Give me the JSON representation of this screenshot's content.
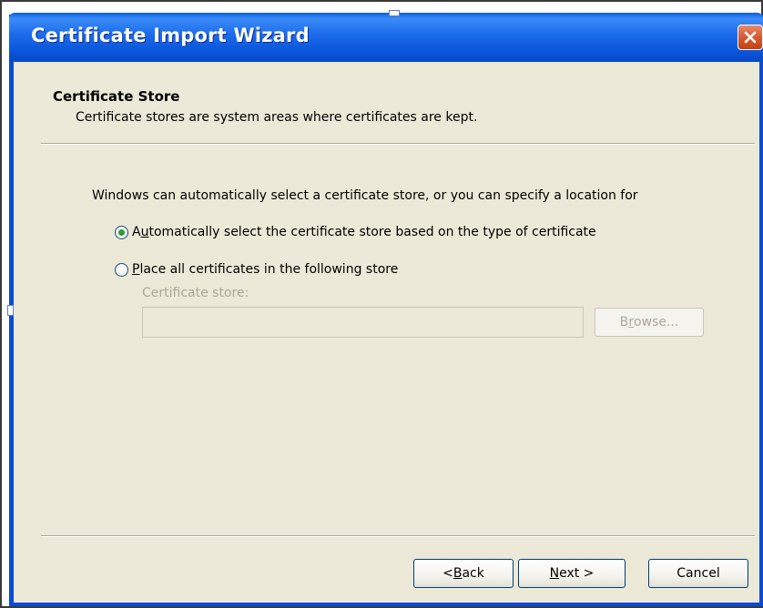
{
  "window": {
    "title": "Certificate Import Wizard",
    "close_icon": "close-icon"
  },
  "header": {
    "title": "Certificate Store",
    "subtitle": "Certificate stores are system areas where certificates are kept."
  },
  "body": {
    "intro": "Windows can automatically select a certificate store, or you can specify a location for",
    "options": [
      {
        "pre": "A",
        "mnemonic": "u",
        "post": "tomatically select the certificate store based on the type of certificate",
        "checked": true
      },
      {
        "pre": "",
        "mnemonic": "P",
        "post": "lace all certificates in the following store",
        "checked": false
      }
    ],
    "store_label": "Certificate store:",
    "store_value": "",
    "browse": {
      "pre": "B",
      "mnemonic": "r",
      "post": "owse..."
    }
  },
  "footer": {
    "back": {
      "pre": "< ",
      "mnemonic": "B",
      "post": "ack"
    },
    "next": {
      "pre": "",
      "mnemonic": "N",
      "post": "ext >"
    },
    "cancel": "Cancel"
  },
  "colors": {
    "titlebar": "#0b57dd",
    "dialog_bg": "#ece9d8",
    "radio_dot": "#2a9b36",
    "disabled_text": "#aca899"
  }
}
